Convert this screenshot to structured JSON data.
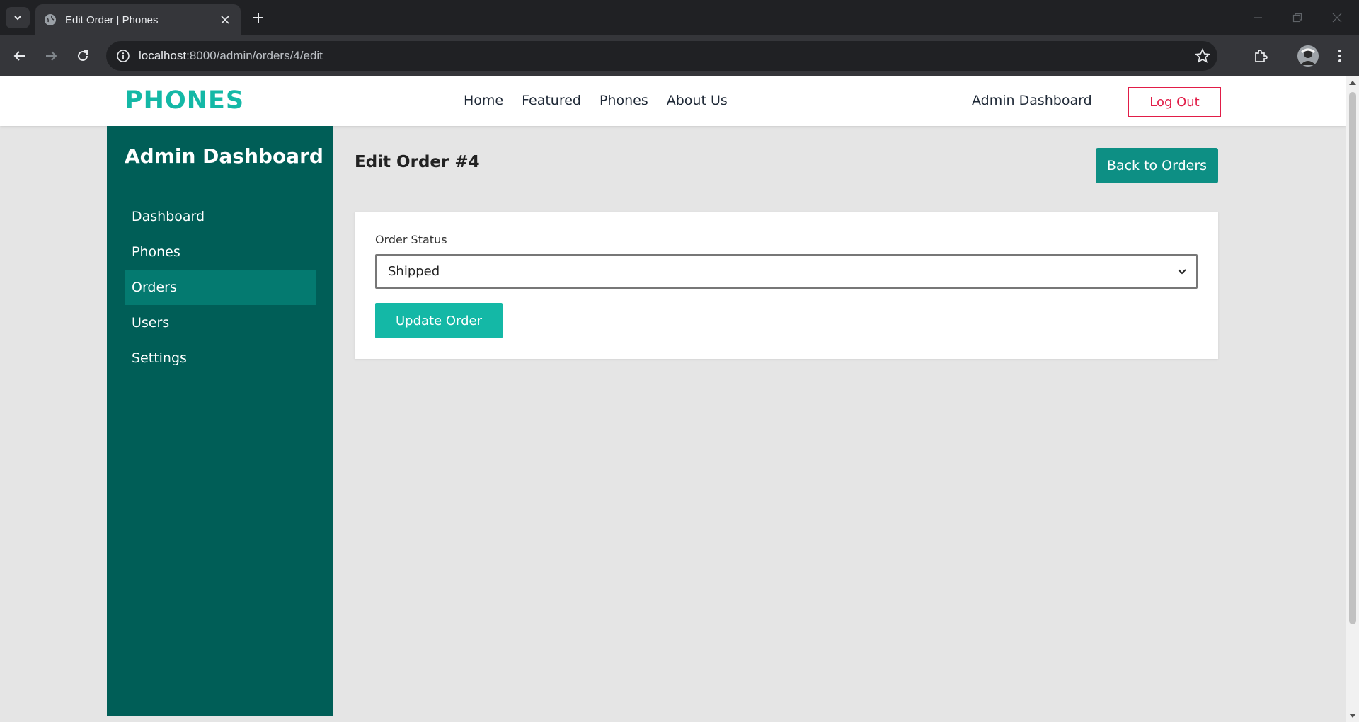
{
  "browser": {
    "tab_title": "Edit Order | Phones",
    "url_host": "localhost",
    "url_rest": ":8000/admin/orders/4/edit"
  },
  "header": {
    "brand": "PHONES",
    "nav": [
      "Home",
      "Featured",
      "Phones",
      "About Us"
    ],
    "admin_link": "Admin Dashboard",
    "logout_label": "Log Out"
  },
  "sidebar": {
    "title": "Admin Dashboard",
    "items": [
      {
        "label": "Dashboard",
        "active": false
      },
      {
        "label": "Phones",
        "active": false
      },
      {
        "label": "Orders",
        "active": true
      },
      {
        "label": "Users",
        "active": false
      },
      {
        "label": "Settings",
        "active": false
      }
    ]
  },
  "main": {
    "title": "Edit Order #4",
    "back_label": "Back to Orders",
    "form": {
      "status_label": "Order Status",
      "status_value": "Shipped",
      "submit_label": "Update Order"
    }
  },
  "colors": {
    "brand": "#14b8a6",
    "sidebar_bg": "#005e57",
    "sidebar_active": "#047a70",
    "back_button": "#0d8f84",
    "logout": "#e11d48"
  }
}
